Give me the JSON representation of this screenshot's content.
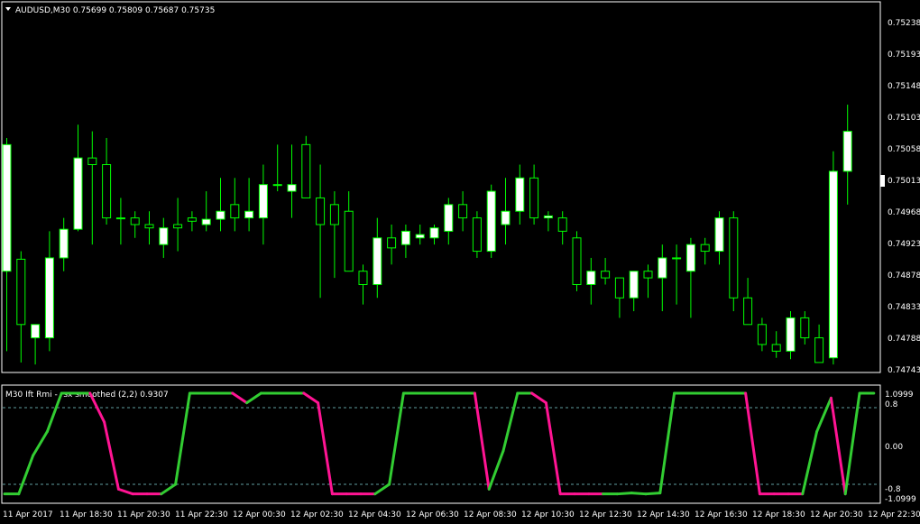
{
  "main_panel": {
    "title": "AUDUSD,M30  0.75699 0.75809 0.75687 0.75735",
    "price_ticks": [
      "0.75238",
      "0.75193",
      "0.75148",
      "0.75103",
      "0.75058",
      "0.75013",
      "0.74968",
      "0.74923",
      "0.74878",
      "0.74833",
      "0.74788",
      "0.74743"
    ],
    "current_price": 0.75013
  },
  "sub_panel": {
    "title": "M30 Ift Rmi - rsx smoothed (2,2) 0.9307",
    "ticks": [
      "1.0999",
      "0.8",
      "0.00",
      "-0.8",
      "-1.0999"
    ]
  },
  "time_labels": [
    "11 Apr 2017",
    "11 Apr 18:30",
    "11 Apr 20:30",
    "11 Apr 22:30",
    "12 Apr 00:30",
    "12 Apr 02:30",
    "12 Apr 04:30",
    "12 Apr 06:30",
    "12 Apr 08:30",
    "12 Apr 10:30",
    "12 Apr 12:30",
    "12 Apr 14:30",
    "12 Apr 16:30",
    "12 Apr 18:30",
    "12 Apr 20:30",
    "12 Apr 22:30"
  ],
  "colors": {
    "background": "#000000",
    "bull_candle": "#ffffff",
    "bear_candle": "#000000",
    "wick": "#00ff00",
    "indicator_up": "#32cd32",
    "indicator_down": "#ff1493",
    "level_line": "#5f9ea0"
  },
  "chart_data": [
    {
      "type": "candlestick",
      "title": "AUDUSD,M30  0.75699 0.75809 0.75687 0.75735",
      "ylim": [
        0.74728,
        0.7526
      ],
      "series": [
        {
          "name": "AUDUSD",
          "ohlc": [
            [
              0.7488,
              0.7508,
              0.7476,
              0.7507
            ],
            [
              0.74898,
              0.7491,
              0.74743,
              0.748
            ],
            [
              0.7478,
              0.748,
              0.7474,
              0.748
            ],
            [
              0.7478,
              0.7494,
              0.7476,
              0.749
            ],
            [
              0.749,
              0.7496,
              0.7488,
              0.74943
            ],
            [
              0.74943,
              0.751,
              0.7494,
              0.7505
            ],
            [
              0.7505,
              0.7509,
              0.7492,
              0.7504
            ],
            [
              0.7504,
              0.7508,
              0.7495,
              0.7496
            ],
            [
              0.7496,
              0.7499,
              0.7492,
              0.7496
            ],
            [
              0.7496,
              0.7497,
              0.7493,
              0.7495
            ],
            [
              0.7495,
              0.7497,
              0.7492,
              0.74945
            ],
            [
              0.7492,
              0.7496,
              0.749,
              0.74945
            ],
            [
              0.7495,
              0.7499,
              0.7491,
              0.74945
            ],
            [
              0.7496,
              0.7497,
              0.7494,
              0.74955
            ],
            [
              0.7495,
              0.75,
              0.7494,
              0.74958
            ],
            [
              0.74958,
              0.7502,
              0.7494,
              0.7497
            ],
            [
              0.7498,
              0.7502,
              0.7494,
              0.7496
            ],
            [
              0.7496,
              0.7502,
              0.7494,
              0.7497
            ],
            [
              0.7496,
              0.7504,
              0.7492,
              0.7501
            ],
            [
              0.7501,
              0.7507,
              0.75,
              0.7501
            ],
            [
              0.75,
              0.7507,
              0.7496,
              0.7501
            ],
            [
              0.7507,
              0.75083,
              0.7499,
              0.7499
            ],
            [
              0.7499,
              0.7504,
              0.7484,
              0.7495
            ],
            [
              0.7498,
              0.75,
              0.7487,
              0.7495
            ],
            [
              0.7497,
              0.75,
              0.749,
              0.7488
            ],
            [
              0.7488,
              0.7489,
              0.7483,
              0.7486
            ],
            [
              0.7486,
              0.7496,
              0.7484,
              0.7493
            ],
            [
              0.7493,
              0.7495,
              0.7489,
              0.74915
            ],
            [
              0.7492,
              0.7495,
              0.749,
              0.7494
            ],
            [
              0.7493,
              0.7495,
              0.7492,
              0.74935
            ],
            [
              0.7493,
              0.7495,
              0.7492,
              0.74945
            ],
            [
              0.7494,
              0.7499,
              0.7492,
              0.7498
            ],
            [
              0.7498,
              0.75,
              0.7494,
              0.7496
            ],
            [
              0.7496,
              0.7497,
              0.749,
              0.7491
            ],
            [
              0.7491,
              0.7501,
              0.749,
              0.75
            ],
            [
              0.7495,
              0.7502,
              0.7492,
              0.7497
            ],
            [
              0.7497,
              0.7504,
              0.7495,
              0.7502
            ],
            [
              0.7502,
              0.7504,
              0.7495,
              0.7496
            ],
            [
              0.7496,
              0.7497,
              0.7494,
              0.74963
            ],
            [
              0.7496,
              0.7497,
              0.7492,
              0.7494
            ],
            [
              0.7493,
              0.7494,
              0.7485,
              0.7486
            ],
            [
              0.7486,
              0.749,
              0.7483,
              0.7488
            ],
            [
              0.7488,
              0.749,
              0.7486,
              0.7487
            ],
            [
              0.7487,
              0.7487,
              0.7481,
              0.7484
            ],
            [
              0.7484,
              0.7488,
              0.7482,
              0.7488
            ],
            [
              0.7488,
              0.7489,
              0.7484,
              0.7487
            ],
            [
              0.7487,
              0.7492,
              0.7482,
              0.749
            ],
            [
              0.749,
              0.7492,
              0.7483,
              0.749
            ],
            [
              0.7488,
              0.7493,
              0.7481,
              0.7492
            ],
            [
              0.7492,
              0.7493,
              0.7489,
              0.7491
            ],
            [
              0.7491,
              0.7497,
              0.7489,
              0.7496
            ],
            [
              0.7496,
              0.7497,
              0.7482,
              0.7484
            ],
            [
              0.7484,
              0.7487,
              0.748,
              0.748
            ],
            [
              0.748,
              0.7481,
              0.7476,
              0.7477
            ],
            [
              0.7477,
              0.7479,
              0.7475,
              0.7476
            ],
            [
              0.7476,
              0.7482,
              0.74748,
              0.7481
            ],
            [
              0.7481,
              0.7482,
              0.7477,
              0.7478
            ],
            [
              0.7478,
              0.748,
              0.74745,
              0.74743
            ],
            [
              0.7475,
              0.7506,
              0.7474,
              0.7503
            ],
            [
              0.7503,
              0.7513,
              0.7498,
              0.7509
            ]
          ]
        }
      ]
    },
    {
      "type": "line",
      "title": "M30 Ift Rmi - rsx smoothed (2,2) 0.9307",
      "ylim": [
        -1.0999,
        1.0999
      ],
      "levels": [
        0.8,
        -0.8
      ],
      "series": [
        {
          "name": "Ift Rmi",
          "values": [
            -1.0,
            -1.0,
            -0.2,
            0.3,
            1.1,
            1.1,
            1.1,
            0.5,
            -0.9,
            -1.0,
            -1.0,
            -1.0,
            -0.8,
            1.1,
            1.1,
            1.1,
            1.1,
            0.9,
            1.1,
            1.1,
            1.1,
            1.1,
            0.9,
            -1.0,
            -1.0,
            -1.0,
            -1.0,
            -0.8,
            1.1,
            1.1,
            1.1,
            1.1,
            1.1,
            1.1,
            -0.9,
            -0.1,
            1.1,
            1.1,
            0.9,
            -1.0,
            -1.0,
            -1.0,
            -1.0,
            -1.0,
            -0.98,
            -1.0,
            -0.98,
            1.1,
            1.1,
            1.1,
            1.1,
            1.1,
            1.1,
            -1.0,
            -1.0,
            -1.0,
            -1.0,
            0.3,
            1.0,
            -1.0,
            1.1,
            1.1
          ],
          "directions": [
            "d",
            "u",
            "u",
            "u",
            "u",
            "u",
            "u",
            "d",
            "d",
            "d",
            "d",
            "d",
            "u",
            "u",
            "u",
            "u",
            "u",
            "d",
            "u",
            "u",
            "u",
            "u",
            "d",
            "d",
            "d",
            "d",
            "d",
            "u",
            "u",
            "u",
            "u",
            "u",
            "u",
            "u",
            "d",
            "u",
            "u",
            "u",
            "d",
            "d",
            "d",
            "d",
            "d",
            "u",
            "u",
            "u",
            "u",
            "u",
            "u",
            "u",
            "u",
            "u",
            "u",
            "d",
            "d",
            "d",
            "d",
            "u",
            "u",
            "d",
            "u",
            "u"
          ]
        }
      ]
    }
  ]
}
